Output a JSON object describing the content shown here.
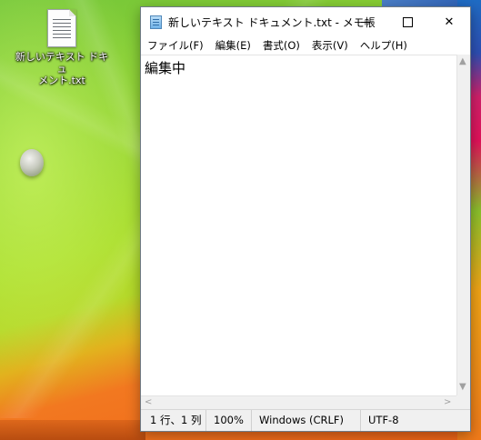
{
  "desktop": {
    "icon": {
      "label_line1": "新しいテキスト ドキュ",
      "label_line2": "メント.txt",
      "icon_name": "text-file-icon"
    }
  },
  "window": {
    "title": "新しいテキスト ドキュメント.txt - メモ帳",
    "app_icon": "notepad-icon",
    "controls": {
      "minimize": "minimize-icon",
      "maximize": "maximize-icon",
      "close_glyph": "✕"
    }
  },
  "menu": {
    "items": [
      {
        "label": "ファイル(F)"
      },
      {
        "label": "編集(E)"
      },
      {
        "label": "書式(O)"
      },
      {
        "label": "表示(V)"
      },
      {
        "label": "ヘルプ(H)"
      }
    ]
  },
  "editor": {
    "content": "編集中"
  },
  "scrollbars": {
    "up": "▲",
    "down": "▼",
    "left": "<",
    "right": ">"
  },
  "status": {
    "position": "1 行、1 列",
    "zoom": "100%",
    "line_ending": "Windows (CRLF)",
    "encoding": "UTF-8"
  }
}
